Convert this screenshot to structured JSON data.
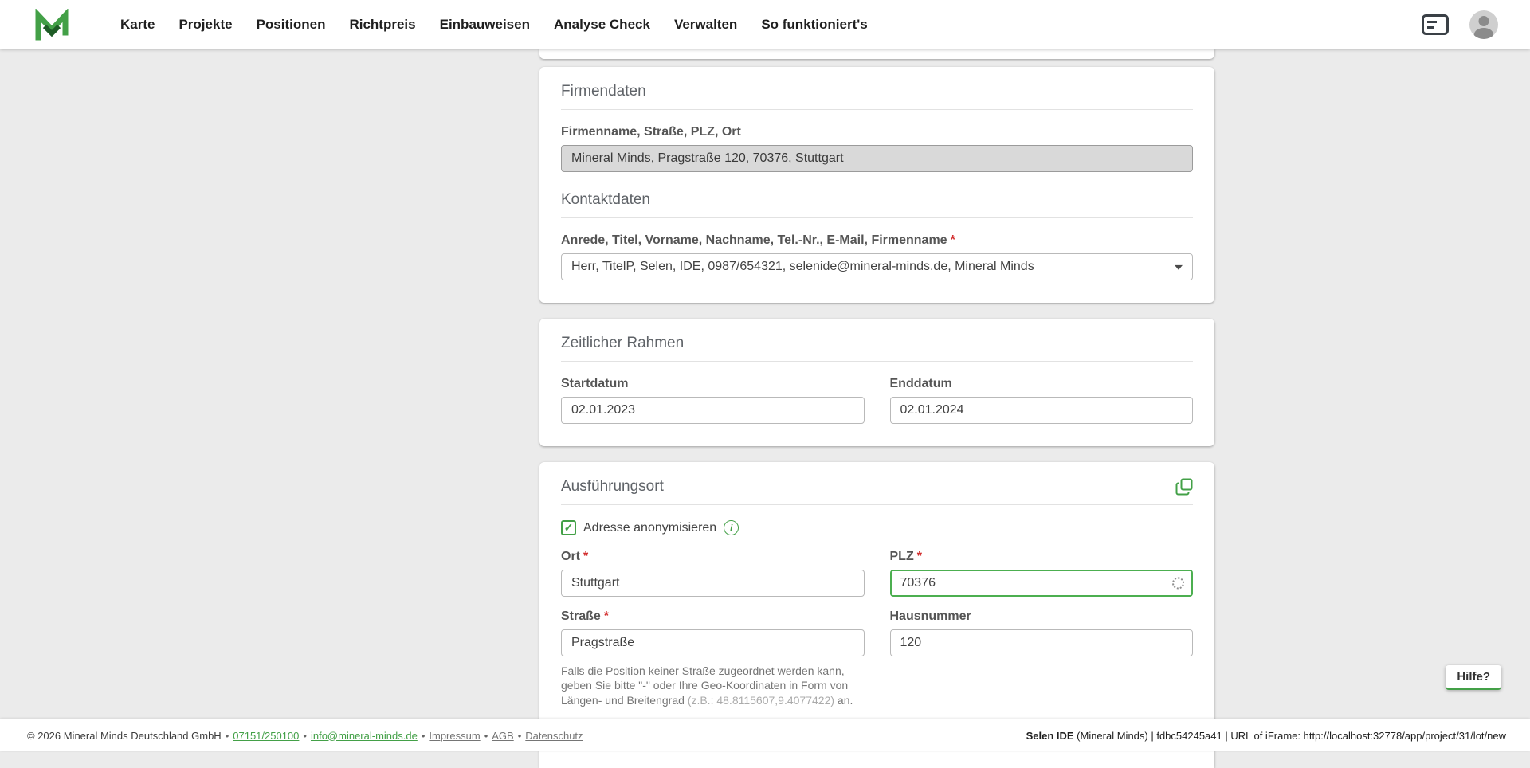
{
  "colors": {
    "accent": "#43a047",
    "focus_border": "#4caf50"
  },
  "icons": {
    "checkmark": "✓",
    "info": "i"
  },
  "required_mark": "*",
  "nav": {
    "items": [
      "Karte",
      "Projekte",
      "Positionen",
      "Richtpreis",
      "Einbauweisen",
      "Analyse Check",
      "Verwalten",
      "So funktioniert's"
    ]
  },
  "firmendaten": {
    "title": "Firmendaten",
    "field_label": "Firmenname, Straße, PLZ, Ort",
    "field_value": "Mineral Minds, Pragstraße 120, 70376, Stuttgart",
    "kontakt_title": "Kontaktdaten",
    "kontakt_label": "Anrede, Titel, Vorname, Nachname, Tel.-Nr., E-Mail, Firmenname",
    "kontakt_value": "Herr, TitelP, Selen, IDE, 0987/654321, selenide@mineral-minds.de, Mineral Minds"
  },
  "zeitraum": {
    "title": "Zeitlicher Rahmen",
    "start_label": "Startdatum",
    "start_value": "02.01.2023",
    "end_label": "Enddatum",
    "end_value": "02.01.2024"
  },
  "ausfuehrungsort": {
    "title": "Ausführungsort",
    "anonymisieren_label": "Adresse anonymisieren",
    "ort_label": "Ort",
    "ort_value": "Stuttgart",
    "plz_label": "PLZ",
    "plz_value": "70376",
    "strasse_label": "Straße",
    "strasse_value": "Pragstraße",
    "hausnummer_label": "Hausnummer",
    "hausnummer_value": "120",
    "hint_text": "Falls die Position keiner Straße zugeordnet werden kann, geben Sie bitte \"-\" oder Ihre Geo-Koordinaten in Form von Längen- und Breitengrad ",
    "hint_example": "(z.B.: 48.8115607,9.4077422)",
    "hint_suffix": " an."
  },
  "help_button": "Hilfe?",
  "footer": {
    "copyright": "© 2026 Mineral Minds Deutschland GmbH",
    "separator": "•",
    "phone": "07151/250100",
    "email": "info@mineral-minds.de",
    "links": [
      "Impressum",
      "AGB",
      "Datenschutz"
    ],
    "right_bold": "Selen IDE",
    "right_rest": " (Mineral Minds) | fdbc54245a41 | URL of iFrame: http://localhost:32778/app/project/31/lot/new"
  }
}
